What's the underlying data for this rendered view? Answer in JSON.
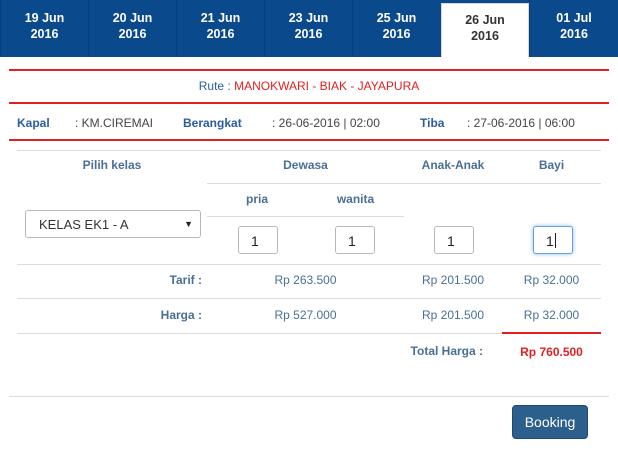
{
  "tabs": [
    {
      "day": "19 Jun",
      "year": "2016"
    },
    {
      "day": "20 Jun",
      "year": "2016"
    },
    {
      "day": "21 Jun",
      "year": "2016"
    },
    {
      "day": "23 Jun",
      "year": "2016"
    },
    {
      "day": "25 Jun",
      "year": "2016"
    },
    {
      "day": "26 Jun",
      "year": "2016"
    },
    {
      "day": "01 Jul",
      "year": "2016"
    }
  ],
  "route": {
    "label": "Rute :",
    "value": "MANOKWARI - BIAK - JAYAPURA"
  },
  "info": {
    "kapal_label": "Kapal",
    "kapal_value": ": KM.CIREMAI",
    "berangkat_label": "Berangkat",
    "berangkat_value": ": 26-06-2016 | 02:00",
    "tiba_label": "Tiba",
    "tiba_value": ": 27-06-2016 | 06:00"
  },
  "table": {
    "h_class": "Pilih kelas",
    "h_dewasa": "Dewasa",
    "h_anak": "Anak-Anak",
    "h_bayi": "Bayi",
    "h_pria": "pria",
    "h_wanita": "wanita",
    "class_selected": "KELAS EK1 - A",
    "qty_pria": "1",
    "qty_wanita": "1",
    "qty_anak": "1",
    "qty_bayi": "1",
    "tarif_label": "Tarif :",
    "tarif_dewasa": "Rp 263.500",
    "tarif_anak": "Rp 201.500",
    "tarif_bayi": "Rp 32.000",
    "harga_label": "Harga :",
    "harga_dewasa": "Rp 527.000",
    "harga_anak": "Rp 201.500",
    "harga_bayi": "Rp 32.000",
    "total_label": "Total Harga :",
    "total_value": "Rp 760.500"
  },
  "booking_label": "Booking"
}
